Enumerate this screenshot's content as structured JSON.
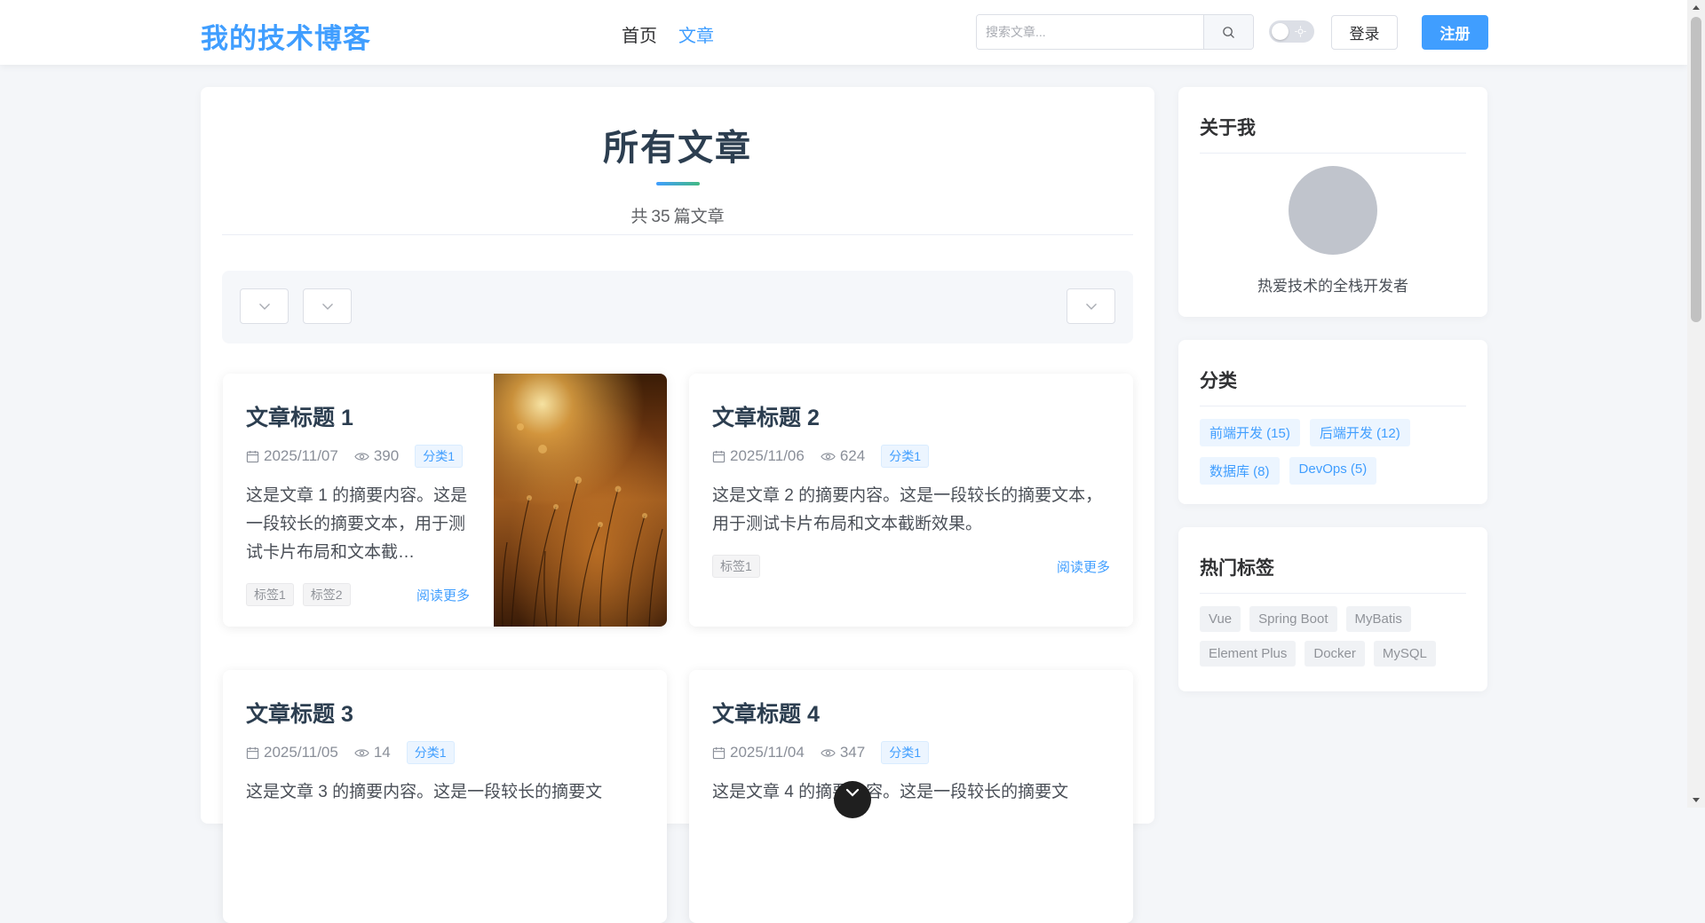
{
  "header": {
    "logo": "我的技术博客",
    "nav": [
      {
        "label": "首页",
        "active": false
      },
      {
        "label": "文章",
        "active": true
      }
    ],
    "search_placeholder": "搜索文章...",
    "login": "登录",
    "register": "注册",
    "theme_toggle": "off"
  },
  "main": {
    "title": "所有文章",
    "count_prefix": "共",
    "count": "35",
    "count_suffix": "篇文章",
    "articles": [
      {
        "title": "文章标题 1",
        "date": "2025/11/07",
        "views": "390",
        "category": "分类1",
        "excerpt": "这是文章 1 的摘要内容。这是一段较长的摘要文本，用于测试卡片布局和文本截…",
        "tags": [
          "标签1",
          "标签2"
        ],
        "read_more": "阅读更多",
        "has_image": true
      },
      {
        "title": "文章标题 2",
        "date": "2025/11/06",
        "views": "624",
        "category": "分类1",
        "excerpt": "这是文章 2 的摘要内容。这是一段较长的摘要文本，用于测试卡片布局和文本截断效果。",
        "tags": [
          "标签1"
        ],
        "read_more": "阅读更多",
        "has_image": false
      },
      {
        "title": "文章标题 3",
        "date": "2025/11/05",
        "views": "14",
        "category": "分类1",
        "excerpt": "这是文章 3 的摘要内容。这是一段较长的摘要文",
        "has_image": false
      },
      {
        "title": "文章标题 4",
        "date": "2025/11/04",
        "views": "347",
        "category": "分类1",
        "excerpt": "这是文章 4 的摘要内容。这是一段较长的摘要文",
        "has_image": false
      }
    ]
  },
  "sidebar": {
    "about": {
      "title": "关于我",
      "bio": "热爱技术的全栈开发者"
    },
    "categories": {
      "title": "分类",
      "items": [
        "前端开发 (15)",
        "后端开发 (12)",
        "数据库 (8)",
        "DevOps (5)"
      ]
    },
    "tags": {
      "title": "热门标签",
      "items": [
        "Vue",
        "Spring Boot",
        "MyBatis",
        "Element Plus",
        "Docker",
        "MySQL"
      ]
    }
  },
  "colors": {
    "accent": "#409eff",
    "heading": "#2c3e50",
    "page_bg": "#f4f6f9"
  }
}
